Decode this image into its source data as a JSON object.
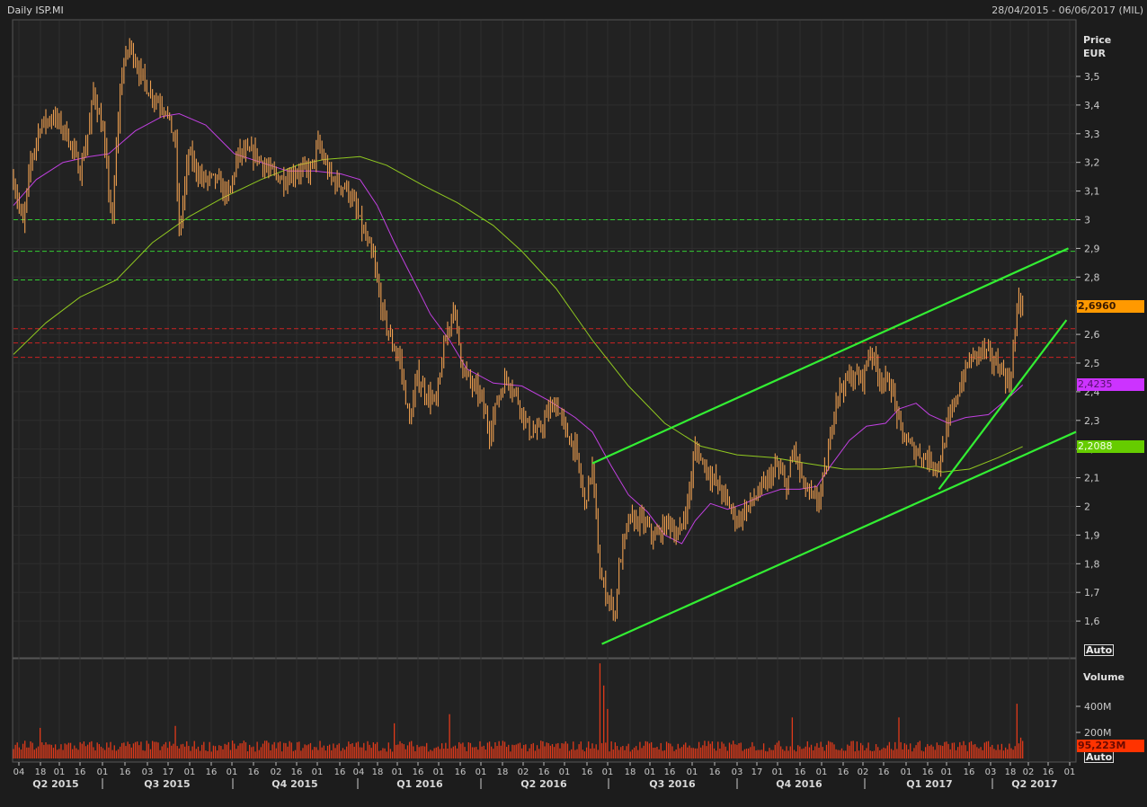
{
  "header": {
    "title": "Daily ISP.MI",
    "date_range": "28/04/2015 - 06/06/2017 (MIL)"
  },
  "price_axis": {
    "label_line1": "Price",
    "label_line2": "EUR",
    "auto": "Auto"
  },
  "volume_axis": {
    "label": "Volume",
    "auto": "Auto"
  },
  "tags": {
    "last_price": "2,6960",
    "ma_short": "2,4235",
    "ma_long": "2,2088",
    "last_volume": "95,223M"
  },
  "colors": {
    "bars": "#f0a050",
    "ma_short": "#c040e0",
    "ma_long": "#90c820",
    "trend": "#33ee33",
    "support": "#33cc33",
    "resistance": "#cc2222",
    "volume": "#e03a1a",
    "tag_price": "#ff9900",
    "tag_ma_short": "#cc33ff",
    "tag_ma_long": "#66cc00",
    "tag_volume": "#ff3300"
  },
  "chart_data": {
    "type": "ohlc",
    "title": "Daily ISP.MI",
    "ylabel": "Price EUR",
    "ylim": [
      1.5,
      3.6
    ],
    "y_ticks": [
      "3,5",
      "3,4",
      "3,3",
      "3,2",
      "3,1",
      "3",
      "2,9",
      "2,8",
      "2,7",
      "2,6",
      "2,5",
      "2,4",
      "2,3",
      "2,2",
      "2,1",
      "2",
      "1,9",
      "1,8",
      "1,7",
      "1,6"
    ],
    "y_tick_values": [
      3.5,
      3.4,
      3.3,
      3.2,
      3.1,
      3.0,
      2.9,
      2.8,
      2.7,
      2.6,
      2.5,
      2.4,
      2.3,
      2.2,
      2.1,
      2.0,
      1.9,
      1.8,
      1.7,
      1.6
    ],
    "x_domain_trading_days": [
      0,
      558
    ],
    "x_day_ticks": [
      "04",
      "18",
      "01",
      "16",
      "01",
      "16",
      "03",
      "17",
      "01",
      "16",
      "01",
      "16",
      "02",
      "16",
      "01",
      "16",
      "04",
      "18",
      "01",
      "16",
      "01",
      "16",
      "01",
      "18",
      "02",
      "16",
      "01",
      "16",
      "01",
      "18",
      "01",
      "16",
      "01",
      "16",
      "03",
      "17",
      "01",
      "16",
      "01",
      "16",
      "02",
      "16",
      "01",
      "16",
      "01",
      "16",
      "03",
      "18",
      "02",
      "16",
      "01"
    ],
    "x_quarters": [
      "Q2 2015",
      "Q3 2015",
      "Q4 2015",
      "Q1 2016",
      "Q2 2016",
      "Q3 2016",
      "Q4 2016",
      "Q1 2017",
      "Q2 2017"
    ],
    "close_points": [
      [
        0,
        3.14
      ],
      [
        5,
        2.98
      ],
      [
        9,
        3.2
      ],
      [
        14,
        3.33
      ],
      [
        21,
        3.36
      ],
      [
        28,
        3.3
      ],
      [
        35,
        3.17
      ],
      [
        40,
        3.33
      ],
      [
        42,
        3.45
      ],
      [
        47,
        3.3
      ],
      [
        52,
        2.98
      ],
      [
        54,
        3.26
      ],
      [
        57,
        3.52
      ],
      [
        61,
        3.61
      ],
      [
        66,
        3.52
      ],
      [
        71,
        3.45
      ],
      [
        75,
        3.42
      ],
      [
        80,
        3.39
      ],
      [
        85,
        3.26
      ],
      [
        87,
        2.95
      ],
      [
        92,
        3.23
      ],
      [
        99,
        3.14
      ],
      [
        106,
        3.14
      ],
      [
        113,
        3.08
      ],
      [
        118,
        3.23
      ],
      [
        127,
        3.23
      ],
      [
        134,
        3.17
      ],
      [
        142,
        3.14
      ],
      [
        149,
        3.17
      ],
      [
        156,
        3.17
      ],
      [
        160,
        3.26
      ],
      [
        167,
        3.14
      ],
      [
        175,
        3.11
      ],
      [
        179,
        3.05
      ],
      [
        184,
        2.95
      ],
      [
        189,
        2.86
      ],
      [
        193,
        2.7
      ],
      [
        198,
        2.58
      ],
      [
        203,
        2.51
      ],
      [
        208,
        2.29
      ],
      [
        212,
        2.45
      ],
      [
        217,
        2.39
      ],
      [
        222,
        2.36
      ],
      [
        226,
        2.55
      ],
      [
        231,
        2.7
      ],
      [
        236,
        2.48
      ],
      [
        241,
        2.42
      ],
      [
        245,
        2.39
      ],
      [
        250,
        2.26
      ],
      [
        255,
        2.39
      ],
      [
        259,
        2.45
      ],
      [
        264,
        2.39
      ],
      [
        271,
        2.26
      ],
      [
        276,
        2.26
      ],
      [
        281,
        2.33
      ],
      [
        285,
        2.36
      ],
      [
        290,
        2.26
      ],
      [
        295,
        2.2
      ],
      [
        300,
        2.01
      ],
      [
        304,
        2.14
      ],
      [
        308,
        1.76
      ],
      [
        311,
        1.7
      ],
      [
        316,
        1.63
      ],
      [
        318,
        1.79
      ],
      [
        323,
        1.95
      ],
      [
        330,
        1.95
      ],
      [
        337,
        1.89
      ],
      [
        344,
        1.95
      ],
      [
        349,
        1.89
      ],
      [
        354,
        2.01
      ],
      [
        358,
        2.2
      ],
      [
        366,
        2.11
      ],
      [
        373,
        2.04
      ],
      [
        380,
        1.95
      ],
      [
        387,
        2.01
      ],
      [
        394,
        2.07
      ],
      [
        401,
        2.14
      ],
      [
        406,
        2.07
      ],
      [
        410,
        2.2
      ],
      [
        415,
        2.07
      ],
      [
        422,
        2.01
      ],
      [
        427,
        2.14
      ],
      [
        432,
        2.39
      ],
      [
        439,
        2.45
      ],
      [
        446,
        2.45
      ],
      [
        450,
        2.55
      ],
      [
        455,
        2.45
      ],
      [
        461,
        2.42
      ],
      [
        466,
        2.26
      ],
      [
        472,
        2.2
      ],
      [
        479,
        2.17
      ],
      [
        486,
        2.14
      ],
      [
        491,
        2.29
      ],
      [
        497,
        2.42
      ],
      [
        502,
        2.51
      ],
      [
        509,
        2.55
      ],
      [
        514,
        2.51
      ],
      [
        519,
        2.48
      ],
      [
        523,
        2.42
      ],
      [
        528,
        2.73
      ],
      [
        530,
        2.696
      ]
    ],
    "ma_short_points": [
      [
        0,
        3.05
      ],
      [
        12,
        3.14
      ],
      [
        26,
        3.2
      ],
      [
        40,
        3.22
      ],
      [
        50,
        3.23
      ],
      [
        64,
        3.31
      ],
      [
        78,
        3.36
      ],
      [
        87,
        3.37
      ],
      [
        101,
        3.33
      ],
      [
        116,
        3.23
      ],
      [
        130,
        3.2
      ],
      [
        144,
        3.17
      ],
      [
        158,
        3.17
      ],
      [
        172,
        3.16
      ],
      [
        182,
        3.14
      ],
      [
        191,
        3.05
      ],
      [
        200,
        2.92
      ],
      [
        210,
        2.79
      ],
      [
        219,
        2.67
      ],
      [
        229,
        2.58
      ],
      [
        238,
        2.48
      ],
      [
        252,
        2.43
      ],
      [
        267,
        2.42
      ],
      [
        281,
        2.37
      ],
      [
        295,
        2.31
      ],
      [
        304,
        2.26
      ],
      [
        314,
        2.14
      ],
      [
        323,
        2.04
      ],
      [
        333,
        1.98
      ],
      [
        342,
        1.9
      ],
      [
        351,
        1.87
      ],
      [
        358,
        1.95
      ],
      [
        366,
        2.01
      ],
      [
        375,
        1.99
      ],
      [
        384,
        2.01
      ],
      [
        394,
        2.04
      ],
      [
        403,
        2.06
      ],
      [
        413,
        2.06
      ],
      [
        422,
        2.07
      ],
      [
        429,
        2.14
      ],
      [
        439,
        2.23
      ],
      [
        448,
        2.28
      ],
      [
        458,
        2.29
      ],
      [
        465,
        2.34
      ],
      [
        474,
        2.36
      ],
      [
        481,
        2.32
      ],
      [
        491,
        2.29
      ],
      [
        500,
        2.31
      ],
      [
        512,
        2.32
      ],
      [
        521,
        2.37
      ],
      [
        530,
        2.4235
      ]
    ],
    "ma_long_points": [
      [
        0,
        2.53
      ],
      [
        17,
        2.64
      ],
      [
        35,
        2.73
      ],
      [
        54,
        2.79
      ],
      [
        73,
        2.92
      ],
      [
        92,
        3.01
      ],
      [
        111,
        3.08
      ],
      [
        130,
        3.14
      ],
      [
        149,
        3.19
      ],
      [
        163,
        3.21
      ],
      [
        182,
        3.22
      ],
      [
        196,
        3.19
      ],
      [
        215,
        3.12
      ],
      [
        233,
        3.06
      ],
      [
        252,
        2.98
      ],
      [
        267,
        2.89
      ],
      [
        285,
        2.76
      ],
      [
        304,
        2.58
      ],
      [
        323,
        2.42
      ],
      [
        342,
        2.29
      ],
      [
        361,
        2.21
      ],
      [
        380,
        2.18
      ],
      [
        399,
        2.17
      ],
      [
        417,
        2.15
      ],
      [
        436,
        2.13
      ],
      [
        455,
        2.13
      ],
      [
        474,
        2.14
      ],
      [
        488,
        2.12
      ],
      [
        502,
        2.13
      ],
      [
        517,
        2.17
      ],
      [
        530,
        2.2088
      ]
    ],
    "support_levels": [
      3.0,
      2.89,
      2.79
    ],
    "resistance_levels": [
      2.62,
      2.57,
      2.52
    ],
    "trendlines": [
      [
        [
          304,
          2.15
        ],
        [
          554,
          2.9
        ]
      ],
      [
        [
          309,
          1.52
        ],
        [
          558,
          2.26
        ]
      ],
      [
        [
          486,
          2.06
        ],
        [
          553,
          2.65
        ]
      ]
    ],
    "last_price": 2.696,
    "volume": {
      "ylim": [
        0,
        780
      ],
      "unit": "M",
      "y_ticks": [
        "400M",
        "200M"
      ],
      "y_tick_values": [
        400,
        200
      ],
      "typical": 95,
      "spikes": [
        [
          14,
          235
        ],
        [
          85,
          250
        ],
        [
          200,
          270
        ],
        [
          229,
          340
        ],
        [
          308,
          730
        ],
        [
          310,
          560
        ],
        [
          312,
          380
        ],
        [
          409,
          315
        ],
        [
          465,
          315
        ],
        [
          527,
          420
        ],
        [
          529,
          160
        ]
      ],
      "last": 95.223
    }
  }
}
